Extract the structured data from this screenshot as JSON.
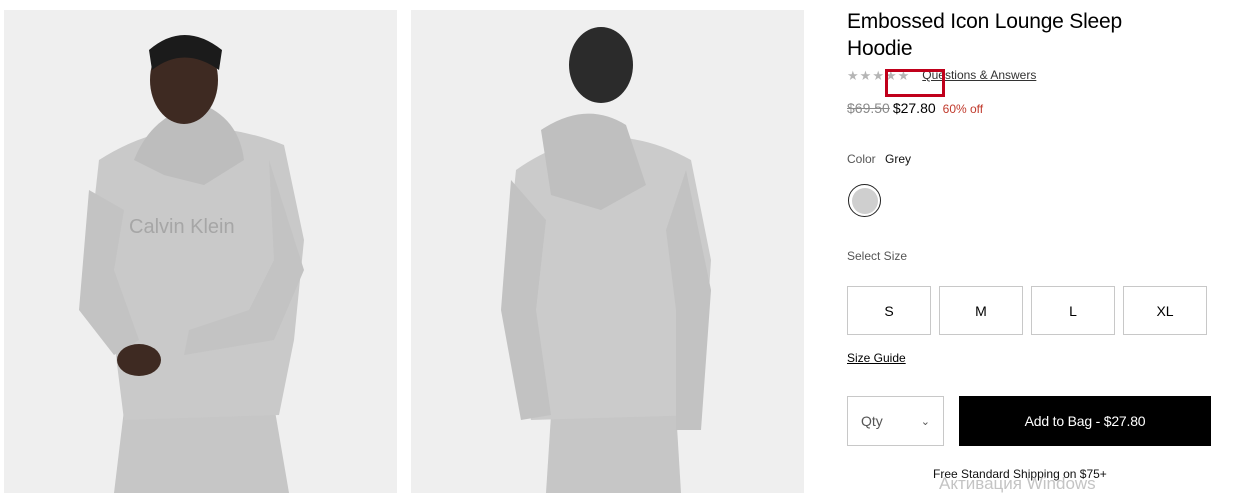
{
  "product": {
    "title": "Embossed Icon Lounge Sleep Hoodie",
    "brand_print": "Calvin Klein",
    "rating": {
      "stars": 5,
      "filled": 0
    },
    "qa_link": "Questions & Answers",
    "original_price": "$69.50",
    "sale_price": "$27.80",
    "discount": "60% off",
    "color_label": "Color",
    "color_value": "Grey",
    "swatch_color": "#cfcfcf",
    "size_label": "Select Size",
    "sizes": [
      "S",
      "M",
      "L",
      "XL"
    ],
    "size_guide": "Size Guide",
    "qty_placeholder": "Qty",
    "add_to_bag": "Add to Bag - $27.80",
    "shipping_note": "Free Standard Shipping on $75+"
  },
  "os_watermark": "Активация Windows",
  "colors": {
    "accent_red": "#c0001b",
    "discount_red": "#c0392b",
    "button_black": "#000000"
  }
}
